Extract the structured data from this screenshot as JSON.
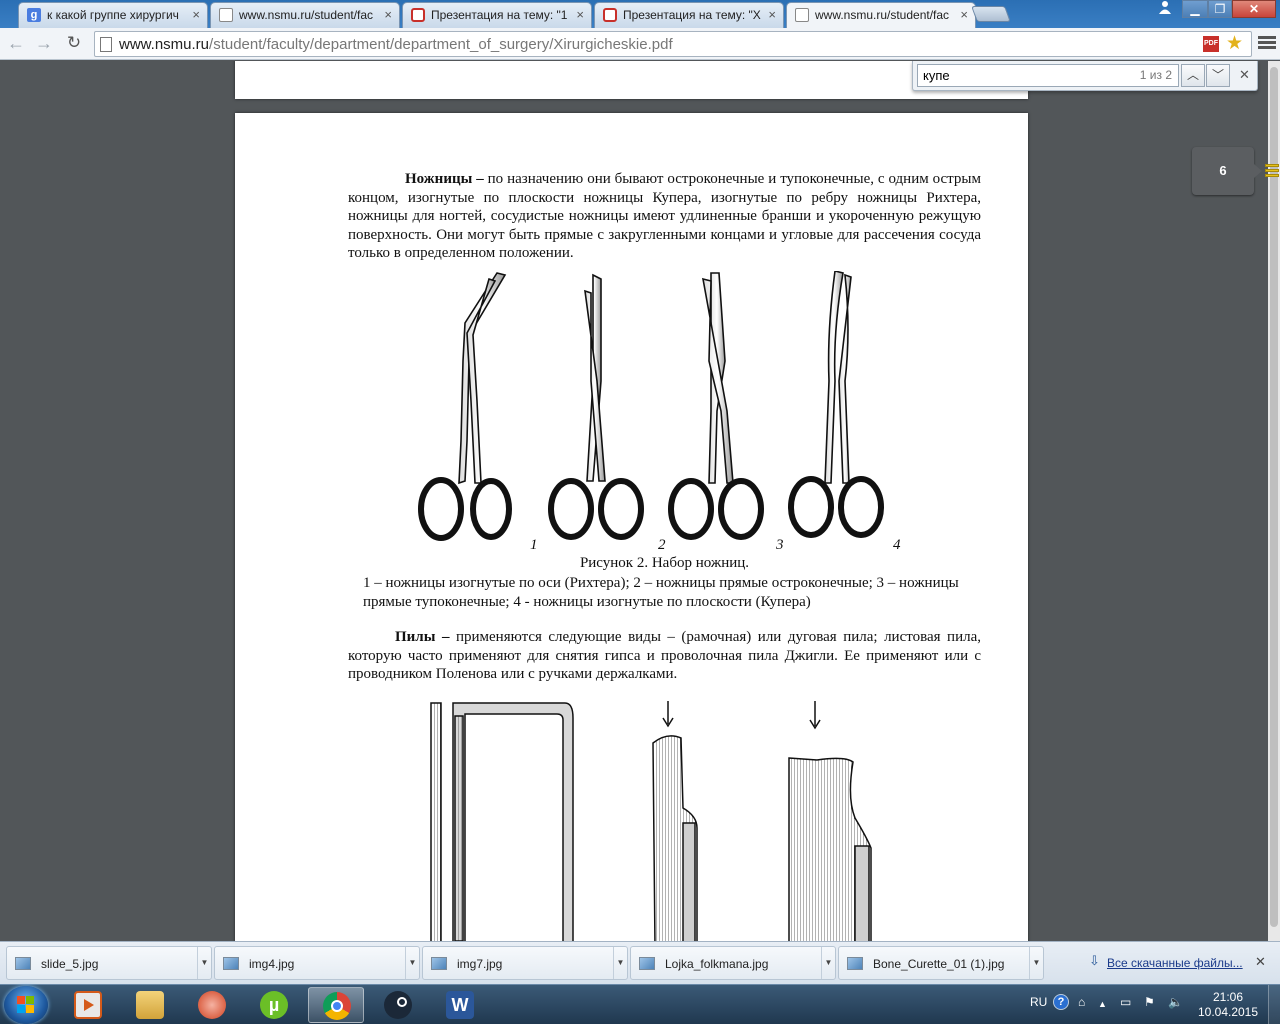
{
  "tabs": [
    {
      "title": "к какой группе хирургич",
      "icon": "google-icon",
      "active": false
    },
    {
      "title": "www.nsmu.ru/student/fac",
      "icon": "document-icon",
      "active": false
    },
    {
      "title": "Презентация на тему: \"1",
      "icon": "presentation-icon",
      "active": false
    },
    {
      "title": "Презентация на тему: \"Х",
      "icon": "presentation-icon",
      "active": false
    },
    {
      "title": "www.nsmu.ru/student/fac",
      "icon": "document-icon",
      "active": true
    }
  ],
  "address_bar": {
    "host": "www.nsmu.ru",
    "path": "/student/faculty/department/department_of_surgery/Xirurgicheskie.pdf"
  },
  "find_bar": {
    "query": "купе",
    "count": "1 из 2"
  },
  "page_indicator": "6",
  "document": {
    "scissors_term": "Ножницы –",
    "scissors_text": " по назначению они бывают остроконечные и тупоконечные, с одним острым концом, изогнутые по плоскости ножницы Купера, изогнутые по ребру ножницы Рихтера, ножницы для ногтей, сосудистые ножницы  имеют удлиненные бранши и укороченную режущую поверхность. Они могут быть прямые  с закругленными концами и угловые  для рассечения сосуда только в определенном положении.",
    "figure_numbers": [
      "1",
      "2",
      "3",
      "4"
    ],
    "figure_caption": "Рисунок 2.  Набор ножниц.",
    "figure_legend": "1 – ножницы изогнутые по оси (Рихтера);  2 – ножницы прямые остроконечные;  3 – ножницы прямые тупоконечные;  4 -  ножницы изогнутые по плоскости (Купера)",
    "saws_term": "Пилы –",
    "saws_text": " применяются следующие виды – (рамочная) или дуговая пила; листовая пила, которую часто применяют для снятия гипса и проволочная пила Джигли. Ее применяют или с проводником Поленова или с ручками держалками."
  },
  "downloads": [
    {
      "name": "slide_5.jpg"
    },
    {
      "name": "img4.jpg"
    },
    {
      "name": "img7.jpg"
    },
    {
      "name": "Lojka_folkmana.jpg"
    },
    {
      "name": "Bone_Curette_01 (1).jpg"
    }
  ],
  "downloads_link": "Все скачанные файлы...",
  "taskbar": {
    "apps": [
      "explorer-icon",
      "media-player-icon",
      "file-manager-icon",
      "ccleaner-icon",
      "utorrent-icon",
      "chrome-icon",
      "steam-icon",
      "word-icon"
    ],
    "language": "RU",
    "time": "21:06",
    "date": "10.04.2015"
  },
  "colors": {
    "titlebar": "#2b6fb4",
    "viewer_background": "#525659",
    "find_highlight": "#e6c21c"
  }
}
